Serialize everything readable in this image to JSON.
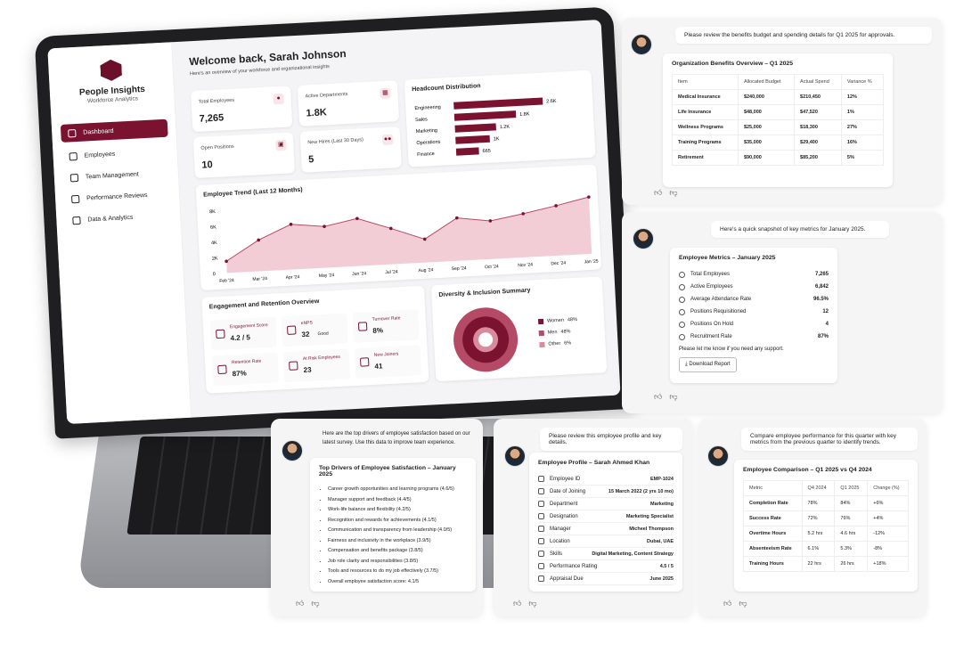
{
  "dashboard": {
    "brand": "People Insights",
    "brand_sub": "Workforce Analytics",
    "nav": [
      "Dashboard",
      "Employees",
      "Team Management",
      "Performance Reviews",
      "Data & Analytics"
    ],
    "welcome": "Welcome back, Sarah Johnson",
    "welcome_sub": "Here's an overview of your workforce and organizational insights",
    "kpis": [
      {
        "label": "Total Employees",
        "value": "7,265"
      },
      {
        "label": "Active Departments",
        "value": "1.8K"
      },
      {
        "label": "Open Positions",
        "value": "10"
      },
      {
        "label": "New Hires (Last 30 Days)",
        "value": "5"
      }
    ],
    "headcount_title": "Headcount Distribution",
    "headcount": [
      {
        "name": "Engineering",
        "label": "2.6K",
        "value": 2600
      },
      {
        "name": "Sales",
        "label": "1.8K",
        "value": 1800
      },
      {
        "name": "Marketing",
        "label": "1.2K",
        "value": 1200
      },
      {
        "name": "Operations",
        "label": "1K",
        "value": 1000
      },
      {
        "name": "Finance",
        "label": "665",
        "value": 665
      }
    ],
    "trend_title": "Employee Trend (Last 12 Months)",
    "trend_y_ticks": [
      "8K",
      "6K",
      "4K",
      "2K",
      "0"
    ],
    "trend_months": [
      "Feb '24",
      "Mar '24",
      "Apr '24",
      "May '24",
      "Jun '24",
      "Jul '24",
      "Aug '24",
      "Sep '24",
      "Oct '24",
      "Nov '24",
      "Dec '24",
      "Jan '25"
    ],
    "trend_values": [
      1500,
      4000,
      5800,
      5300,
      6100,
      4600,
      3000,
      5500,
      4900,
      5600,
      6400,
      7300
    ],
    "engagement_title": "Engagement and Retention Overview",
    "engagement": [
      {
        "label": "Engagement Score",
        "value": "4.2 / 5"
      },
      {
        "label": "eNPS",
        "value": "32",
        "note": "Good"
      },
      {
        "label": "Turnover Rate",
        "value": "8%"
      },
      {
        "label": "Retention Rate",
        "value": "87%"
      },
      {
        "label": "At Risk Employees",
        "value": "23"
      },
      {
        "label": "New Joiners",
        "value": "41"
      }
    ],
    "diversity_title": "Diversity & Inclusion Summary",
    "diversity": [
      {
        "name": "Women",
        "value": "48%"
      },
      {
        "name": "Men",
        "value": "48%"
      },
      {
        "name": "Other",
        "value": "6%"
      }
    ]
  },
  "benefits": {
    "prompt": "Please review the benefits budget and spending details for Q1 2025 for approvals.",
    "title": "Organization Benefits Overview – Q1 2025",
    "headers": [
      "Item",
      "Allocated Budget",
      "Actual Spend",
      "Variance %"
    ],
    "rows": [
      [
        "Medical Insurance",
        "$240,000",
        "$210,450",
        "12%"
      ],
      [
        "Life Insurance",
        "$48,000",
        "$47,520",
        "1%"
      ],
      [
        "Wellness Programs",
        "$25,000",
        "$18,300",
        "27%"
      ],
      [
        "Training Programs",
        "$35,000",
        "$29,400",
        "16%"
      ],
      [
        "Retirement",
        "$90,000",
        "$85,200",
        "5%"
      ]
    ]
  },
  "metrics": {
    "prompt": "Here's a quick snapshot of key metrics for January 2025.",
    "title": "Employee Metrics – January 2025",
    "rows": [
      [
        "Total Employees",
        "7,265"
      ],
      [
        "Active Employees",
        "6,842"
      ],
      [
        "Average Attendance Rate",
        "96.5%"
      ],
      [
        "Positions Requisitioned",
        "12"
      ],
      [
        "Positions On Hold",
        "4"
      ],
      [
        "Recruitment Rate",
        "87%"
      ]
    ],
    "footer": "Please let me know if you need any support.",
    "button": "Download Report"
  },
  "drivers": {
    "prompt": "Here are the top drivers of employee satisfaction based on our latest survey. Use this data to improve team experience.",
    "title": "Top Drivers of Employee Satisfaction – January 2025",
    "items": [
      "Career growth opportunities and learning programs (4.6/5)",
      "Manager support and feedback (4.4/5)",
      "Work-life balance and flexibility (4.2/5)",
      "Recognition and rewards for achievements (4.1/5)",
      "Communication and transparency from leadership (4.0/5)",
      "Fairness and inclusivity in the workplace (3.9/5)",
      "Compensation and benefits package (3.8/5)",
      "Job role clarity and responsibilities (3.8/5)",
      "Tools and resources to do my job effectively (3.7/5)",
      "Overall employee satisfaction score: 4.1/5"
    ]
  },
  "profile": {
    "prompt": "Please review this employee profile and key details.",
    "title": "Employee Profile – Sarah Ahmed Khan",
    "rows": [
      [
        "Employee ID",
        "EMP-1024"
      ],
      [
        "Date of Joining",
        "15 March 2022 (2 yrs 10 mo)"
      ],
      [
        "Department",
        "Marketing"
      ],
      [
        "Designation",
        "Marketing Specialist"
      ],
      [
        "Manager",
        "Micheel Thompson"
      ],
      [
        "Location",
        "Dubai, UAE"
      ],
      [
        "Skills",
        "Digital Marketing, Content Strategy"
      ],
      [
        "Performance Rating",
        "4.5 / 5"
      ],
      [
        "Appraisal Due",
        "June 2025"
      ]
    ]
  },
  "comparison": {
    "prompt": "Compare employee performance for this quarter with key metrics from the previous quarter to identify trends.",
    "title": "Employee Comparison – Q1 2025 vs Q4 2024",
    "headers": [
      "Metric",
      "Q4 2024",
      "Q1 2025",
      "Change (%)"
    ],
    "rows": [
      [
        "Completion Rate",
        "78%",
        "84%",
        "+6%"
      ],
      [
        "Success Rate",
        "72%",
        "76%",
        "+4%"
      ],
      [
        "Overtime Hours",
        "5.2 hrs",
        "4.6 hrs",
        "-12%"
      ],
      [
        "Absenteeism Rate",
        "6.1%",
        "5.3%",
        "-8%"
      ],
      [
        "Training Hours",
        "22 hrs",
        "26 hrs",
        "+18%"
      ]
    ]
  },
  "colors": {
    "accent": "#7a1230",
    "accent_light": "#e8a6b5",
    "panel": "#f5f5f5"
  },
  "icons": {
    "like": "thumbs-up-icon",
    "dislike": "thumbs-down-icon"
  }
}
